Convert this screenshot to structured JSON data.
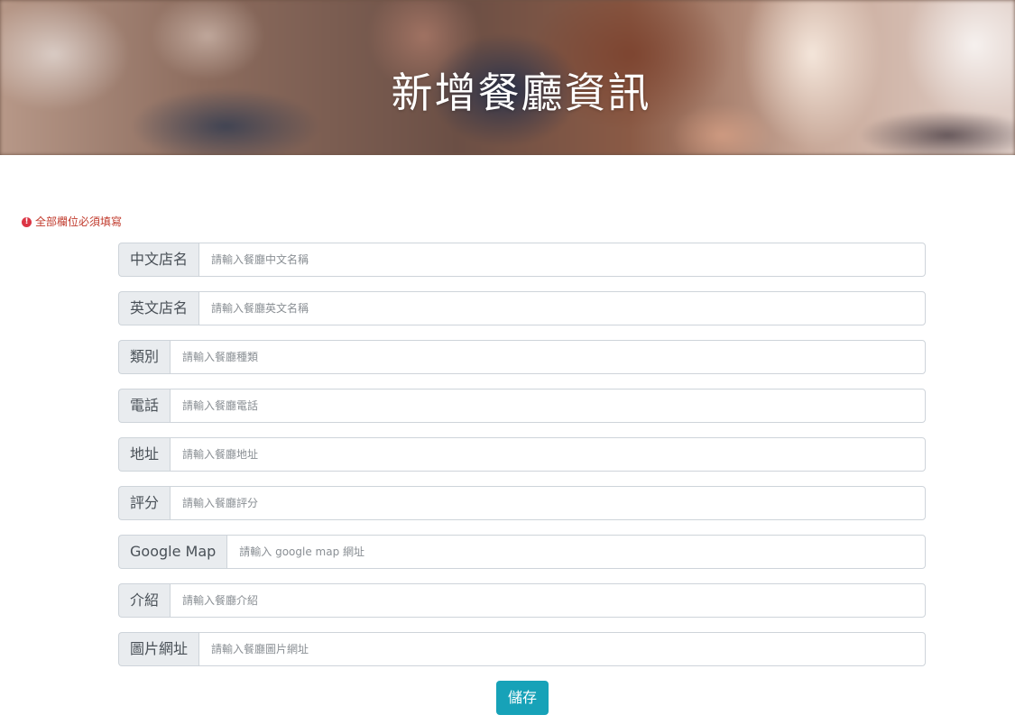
{
  "hero": {
    "title": "新增餐廳資訊"
  },
  "notice": {
    "icon": "exclamation-circle-icon",
    "text": "全部欄位必須填寫",
    "color": "#dc3545"
  },
  "form": {
    "fields": [
      {
        "label": "中文店名",
        "placeholder": "請輸入餐廳中文名稱",
        "value": ""
      },
      {
        "label": "英文店名",
        "placeholder": "請輸入餐廳英文名稱",
        "value": ""
      },
      {
        "label": "類別",
        "placeholder": "請輸入餐廳種類",
        "value": ""
      },
      {
        "label": "電話",
        "placeholder": "請輸入餐廳電話",
        "value": ""
      },
      {
        "label": "地址",
        "placeholder": "請輸入餐廳地址",
        "value": ""
      },
      {
        "label": "評分",
        "placeholder": "請輸入餐廳評分",
        "value": ""
      },
      {
        "label": "Google Map",
        "placeholder": "請輸入 google map 網址",
        "value": ""
      },
      {
        "label": "介紹",
        "placeholder": "請輸入餐廳介紹",
        "value": ""
      },
      {
        "label": "圖片網址",
        "placeholder": "請輸入餐廳圖片網址",
        "value": ""
      }
    ],
    "save_label": "儲存"
  },
  "colors": {
    "accent": "#17a2b8",
    "label_bg": "#e9ecef",
    "border": "#ced4da"
  }
}
